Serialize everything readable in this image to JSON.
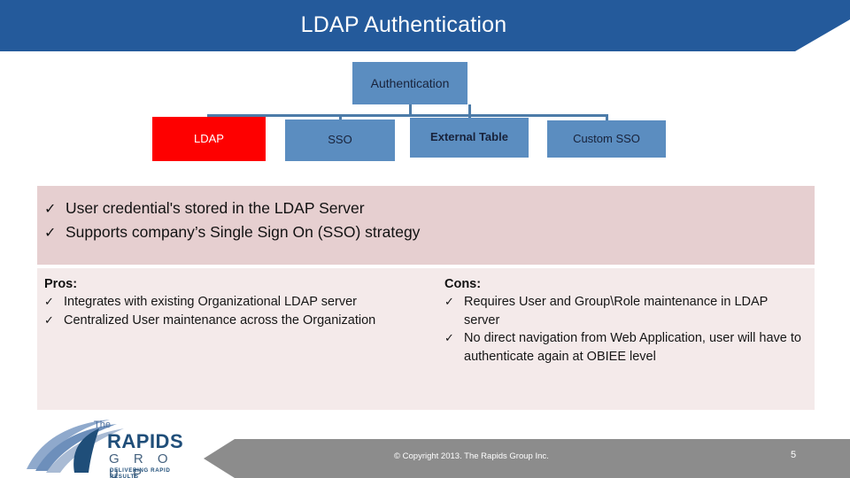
{
  "header": {
    "title": "LDAP Authentication",
    "band_color": "#245A9B"
  },
  "org_chart": {
    "root": {
      "label": "Authentication",
      "color": "#5B8DC0"
    },
    "children": [
      {
        "label": "LDAP",
        "color": "#FE0000",
        "highlighted": "true"
      },
      {
        "label": "SSO",
        "color": "#5B8DC0"
      },
      {
        "label": "External Table",
        "color": "#5B8DC0"
      },
      {
        "label": "Custom SSO",
        "color": "#5B8DC0"
      }
    ],
    "connector_color": "#4C7BA8"
  },
  "bullets": {
    "panel_color": "#E6CFD0",
    "tick": "✓",
    "items": [
      "User credential's stored in the LDAP Server",
      "Supports company’s Single Sign On (SSO) strategy"
    ]
  },
  "proscons": {
    "panel_color": "#F4EAEA",
    "tick": "✓",
    "pros": {
      "heading": "Pros:",
      "items": [
        "Integrates with existing Organizational LDAP server",
        "Centralized User maintenance across the Organization"
      ]
    },
    "cons": {
      "heading": "Cons:",
      "items": [
        "Requires User and Group\\Role maintenance in LDAP server",
        "No direct navigation from Web Application,  user will have to authenticate again at OBIEE level"
      ]
    }
  },
  "footer": {
    "bar_color": "#8C8C8C",
    "copyright": "© Copyright 2013. The Rapids Group Inc.",
    "page_number": "5"
  },
  "logo": {
    "word_the": "The",
    "word_rapids": "RAPIDS",
    "word_group": "G R O U P",
    "tagline": "DELIVERING RAPID RESULTS"
  }
}
